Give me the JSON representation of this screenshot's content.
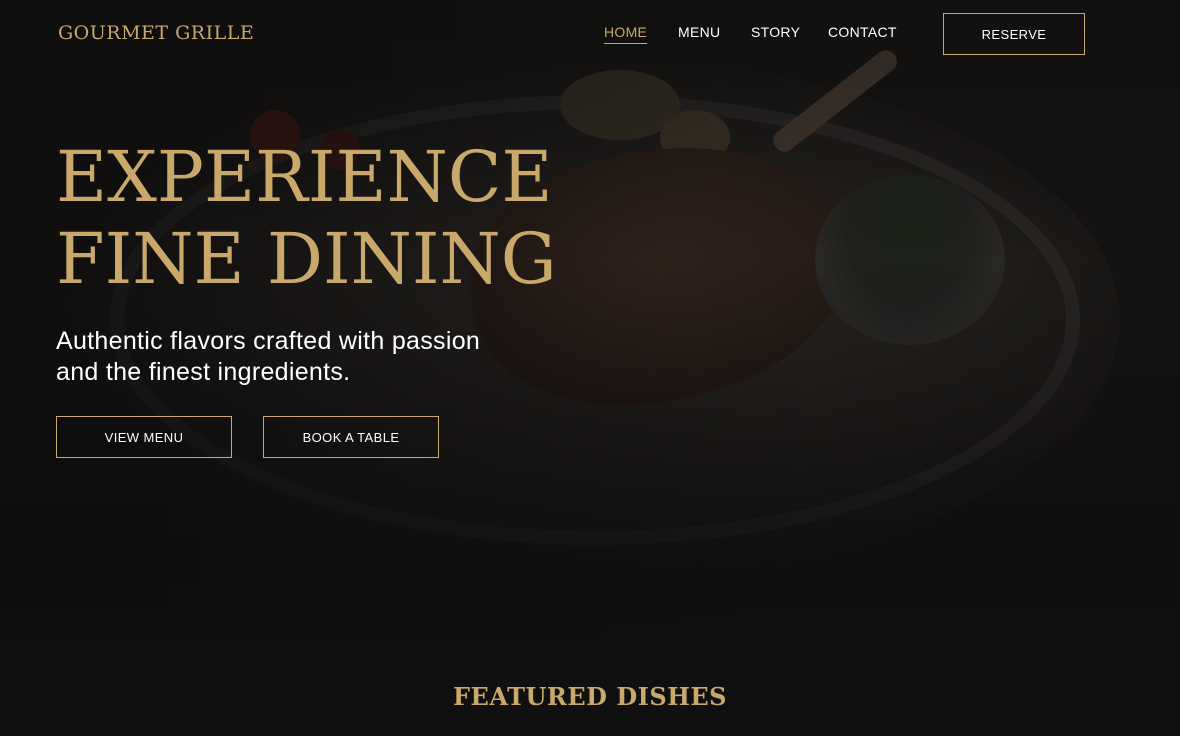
{
  "header": {
    "logo": "GOURMET GRILLE",
    "nav": [
      {
        "label": "HOME",
        "active": true
      },
      {
        "label": "MENU",
        "active": false
      },
      {
        "label": "STORY",
        "active": false
      },
      {
        "label": "CONTACT",
        "active": false
      }
    ],
    "reserve_label": "RESERVE"
  },
  "hero": {
    "title_line1": "EXPERIENCE",
    "title_line2": "FINE DINING",
    "subtitle": "Authentic flavors crafted with passion and the finest ingredients.",
    "view_menu_label": "VIEW MENU",
    "book_table_label": "BOOK A TABLE"
  },
  "featured": {
    "title": "FEATURED DISHES"
  },
  "colors": {
    "accent_gold": "#c9a86c",
    "background": "#111010",
    "text": "#ffffff"
  }
}
